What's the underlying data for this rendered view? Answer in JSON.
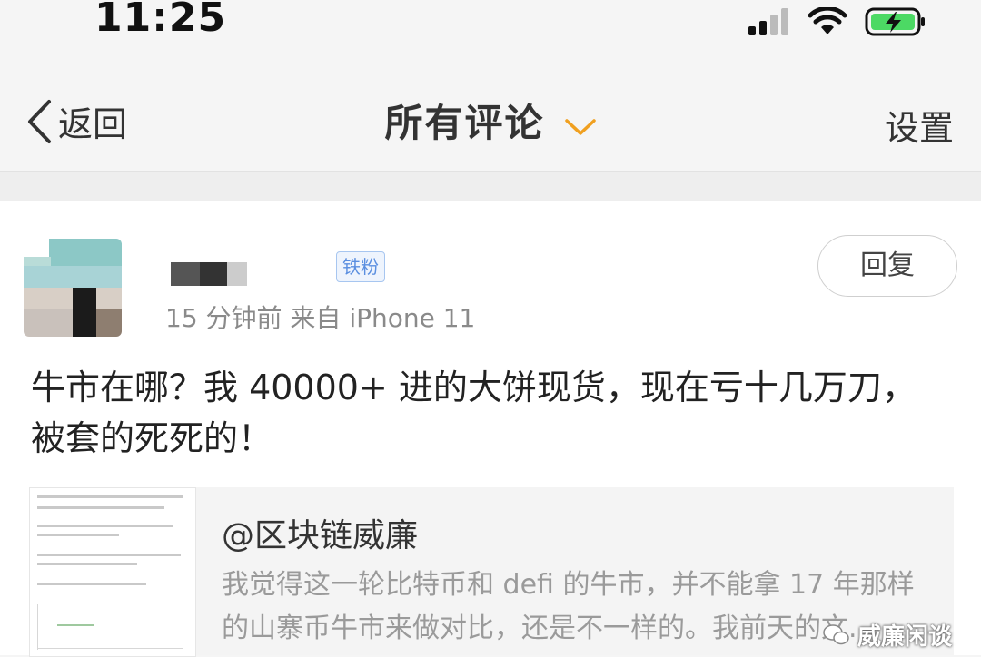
{
  "status_bar": {
    "time": "11:25",
    "battery_color": "#4cd964"
  },
  "nav": {
    "back_label": "返回",
    "title": "所有评论",
    "settings_label": "设置",
    "chevron_color": "#f0a020"
  },
  "comment": {
    "badge": "铁粉",
    "meta": "15 分钟前  来自 iPhone 11",
    "reply_label": "回复",
    "text": "牛市在哪？我 40000+ 进的大饼现货，现在亏十几万刀，被套的死死的！"
  },
  "quoted_post": {
    "author": "@区块链威廉",
    "excerpt": "我觉得这一轮比特币和 defi 的牛市，并不能拿 17 年那样的山寨币牛市来做对比，还是不一样的。我前天的文..."
  },
  "watermark": {
    "text": "威廉闲谈"
  }
}
